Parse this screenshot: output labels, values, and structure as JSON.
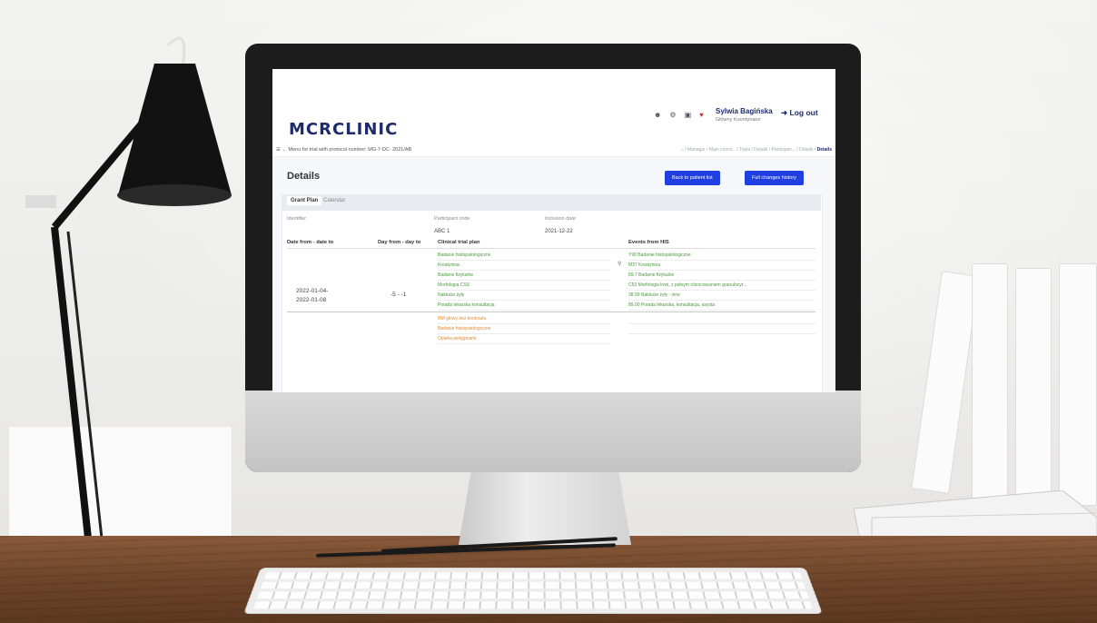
{
  "app": {
    "logo": "MCRCLINIC",
    "user_name": "Sylwia Bagińska",
    "user_role": "Główny Koordynator",
    "logout_label": "Log out",
    "menu_text": "Menu for trial with protocol number: MG-7-DC- 2021/AB",
    "breadcrumb": "/ Manager / Main coord... / Trials / Details / Participan... / Details /",
    "breadcrumb_current": "Details",
    "page_title": "Details",
    "buttons": {
      "back": "Back to patient list",
      "history": "Full changes history"
    },
    "tabs": [
      "Grant Plan",
      "Calendar"
    ],
    "fields": {
      "identifier_label": "Identifier",
      "participant_label": "Participant code",
      "participant_value": "ABC 1",
      "inclusion_label": "Inclusion date",
      "inclusion_value": "2021-12-22"
    },
    "table": {
      "headers": [
        "Date from - date to",
        "Day from - day to",
        "Clinical trial plan",
        "Events from HIS"
      ],
      "date_from": "2022-01-04-",
      "date_to": "2022-01-08",
      "day_range": "-5 - -1",
      "plan": [
        "Badanie histopatologiczne",
        "Kreatynina",
        "Badanie fizykalne",
        "Morfologia CSS",
        "Nakłucie żyły",
        "Porada lekarska konsultacja"
      ],
      "his": [
        "Y90 Badanie histopatologiczne",
        "M37 Kreatynina",
        "89.7 Badanie fizykalne",
        "C53 Morfologia krwi, z pełnym różnicowaniem granulocyt...",
        "38.99 Nakłucie żyły - inne",
        "89.00 Porada lekarska, konsultacja, asysta"
      ],
      "plan_next": [
        "RM głowy bez kontrastu",
        "Badanie histopatologiczne",
        "Opieka pielęgniarki"
      ]
    }
  },
  "colors": {
    "brand": "#1d2b6b",
    "button": "#1f3fe0",
    "matched": "#4a9a3c",
    "unmatched": "#e08a3a"
  },
  "icons": [
    "menu-icon",
    "back-arrow-icon",
    "user-icon",
    "settings-icon",
    "calendar-icon",
    "bell-icon",
    "logout-icon",
    "home-icon",
    "search-icon"
  ]
}
